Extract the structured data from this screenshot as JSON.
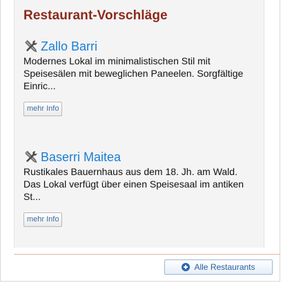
{
  "widget": {
    "title": "Restaurant-Vorschläge",
    "restaurants": [
      {
        "name": "Zallo Barri",
        "description": "Modernes Lokal im minimalistischen Stil mit Speisesälen mit beweglichen Paneelen. Sorgfältige Einric...",
        "more_label": "mehr Info",
        "icon": "tools-icon"
      },
      {
        "name": "Baserri Maitea",
        "description": "Rustikales Bauernhaus aus dem 18. Jh. am Wald. Das Lokal verfügt über einen Speisesaal im antiken St...",
        "more_label": "mehr Info",
        "icon": "tools-icon"
      }
    ],
    "all_button_label": "Alle Restaurants",
    "all_button_icon": "plus-circle-icon",
    "colors": {
      "title": "#8c2a1b",
      "link": "#1a7ed6",
      "divider": "#e2b9a6",
      "button_text": "#2b5f99"
    }
  }
}
